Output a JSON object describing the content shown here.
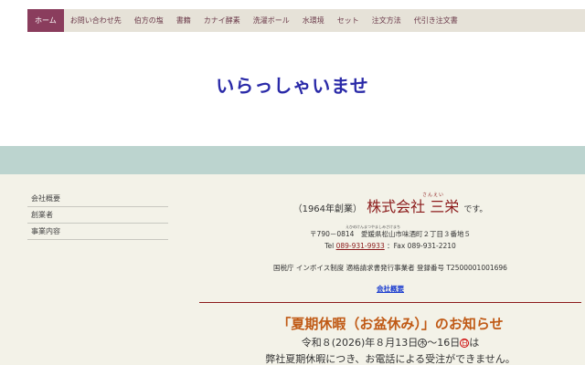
{
  "nav": {
    "items": [
      {
        "label": "ホーム",
        "active": true
      },
      {
        "label": "お問い合わせ先"
      },
      {
        "label": "伯方の塩"
      },
      {
        "label": "書籍"
      },
      {
        "label": "カナイ酵素"
      },
      {
        "label": "洗濯ボール"
      },
      {
        "label": "水環境"
      },
      {
        "label": "セット"
      },
      {
        "label": "注文方法"
      },
      {
        "label": "代引き注文書"
      }
    ]
  },
  "hero": {
    "title": "いらっしゃいませ"
  },
  "sidebar": {
    "items": [
      {
        "label": "会社概要"
      },
      {
        "label": "創業者"
      },
      {
        "label": "事業内容"
      }
    ]
  },
  "company": {
    "founded": "（1964年創業）",
    "name": "株式会社 三栄",
    "name_ruby": "さんえい",
    "suffix": "です。",
    "address_furigana": "えひめけんまつやましみさけまち",
    "address": "〒790－0814　愛媛県松山市味酒町２丁目３番地５",
    "tel_prefix": "Tel",
    "tel_number": "089-931-9933",
    "fax": "：Fax 089-931-2210",
    "invoice": "国税庁 インボイス制度 適格請求書発行事業者 登録番号 T2500001001696",
    "overview_link": "会社概要"
  },
  "notice": {
    "title": "「夏期休暇（お盆休み）」のお知らせ",
    "dates_prefix": "令和８(2026)年８月13日",
    "day_start": "木",
    "dates_mid": "～16日",
    "day_end": "日",
    "dates_suffix": "は",
    "line2": "弊社夏期休暇につき、お電話による受注ができません。"
  },
  "colors": {
    "nav_bg": "#e6e2d8",
    "nav_active": "#8a3d5d",
    "band": "#bcd4cf",
    "content_bg": "#f3f2e8",
    "hero_title": "#2a2aa8",
    "company_name": "#8b1a1a",
    "notice_title": "#c05a16"
  }
}
